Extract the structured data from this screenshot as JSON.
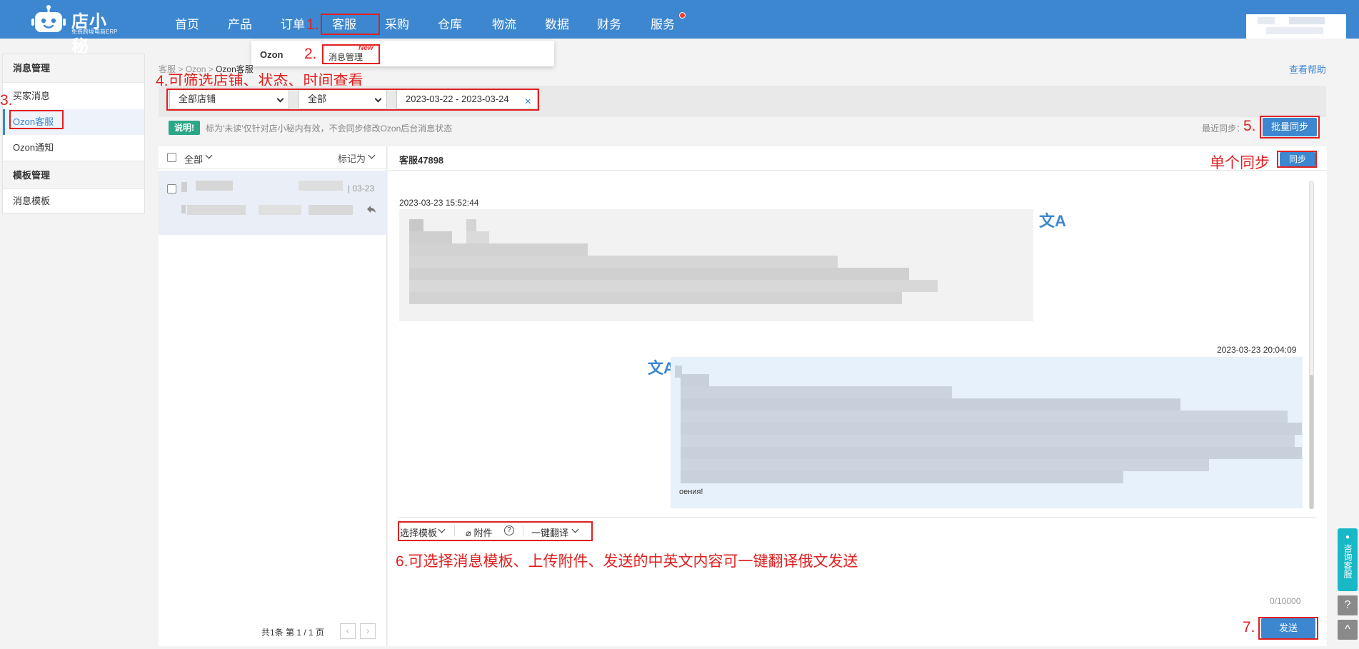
{
  "app": {
    "brand": "店小秘",
    "slogan": "免费跨境电商ERP"
  },
  "nav": {
    "items": [
      "首页",
      "产品",
      "订单",
      "客服",
      "采购",
      "仓库",
      "物流",
      "数据",
      "财务",
      "服务"
    ],
    "active": "客服"
  },
  "dropdown": {
    "category": "Ozon",
    "item": "消息管理",
    "badge": "New"
  },
  "annotations": {
    "a1": "1.",
    "a2": "2.",
    "a3": "3.",
    "a4": "4.可筛选店铺、状态、时间查看",
    "a5": "5.",
    "a_single": "单个同步",
    "a6": "6.可选择消息模板、上传附件、发送的中英文内容可一键翻译俄文发送",
    "a7": "7."
  },
  "sidebar": {
    "sections": [
      {
        "title": "消息管理",
        "items": [
          "买家消息",
          "Ozon客服",
          "Ozon通知"
        ]
      },
      {
        "title": "模板管理",
        "items": [
          "消息模板"
        ]
      }
    ],
    "active_item": "Ozon客服"
  },
  "breadcrumb": [
    "客服",
    "Ozon",
    "Ozon客服"
  ],
  "help_link": "查看帮助",
  "filters": {
    "shop": "全部店铺",
    "status": "全部",
    "date_range": "2023-03-22 - 2023-03-24"
  },
  "note": {
    "badge": "说明!",
    "text": "标为'未读'仅针对店小秘内有效，不会同步修改Ozon后台消息状态"
  },
  "sync": {
    "last_sync_label": "最近同步：",
    "batch_button": "批量同步",
    "single_button": "同步"
  },
  "list": {
    "select_all": "全部",
    "mark_as": "标记为",
    "item_date": "| 03-23",
    "pager": "共1条  第 1 / 1 页"
  },
  "chat": {
    "title": "客服47898",
    "msg_in_time": "2023-03-23 15:52:44",
    "msg_out_time": "2023-03-23 20:04:09",
    "msg_out_tail": "оения!",
    "translate_icon": "文A"
  },
  "toolbar": {
    "template": "选择模板",
    "attachment": "附件",
    "translate": "一键翻译"
  },
  "compose": {
    "counter": "0/10000",
    "send": "发送"
  },
  "float": {
    "service": "咨询客服",
    "help_icon": "?",
    "top_icon": "^"
  },
  "colors": {
    "primary": "#3c87d0",
    "annotation": "#e02020",
    "note_badge": "#2aa786",
    "float_service": "#18b8c7"
  }
}
